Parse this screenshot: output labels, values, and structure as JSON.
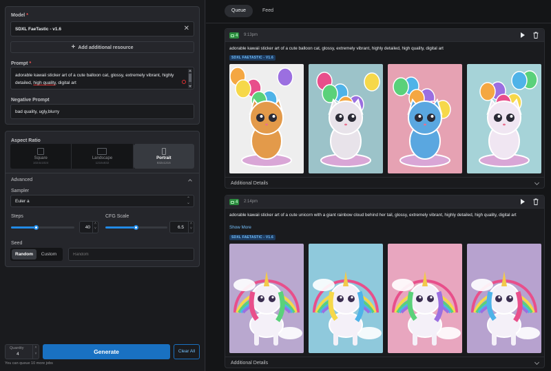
{
  "model": {
    "label": "Model",
    "required": "*",
    "value": "SDXL FaeTastic - v1.6",
    "add_resource": "Add additional resource"
  },
  "prompt": {
    "label": "Prompt",
    "required": "*",
    "text_before": "adorable kawaii sticker art of a cute balloon cat, glossy, extremely vibrant, highly detailed, ",
    "text_underlined": "high quality",
    "text_after": ", digital art"
  },
  "negative_prompt": {
    "label": "Negative Prompt",
    "value": "bad quality, ugly,blurry"
  },
  "aspect_ratio": {
    "label": "Aspect Ratio",
    "options": [
      {
        "name": "Square",
        "size": "1024x1024"
      },
      {
        "name": "Landscape",
        "size": "1216x832"
      },
      {
        "name": "Portrait",
        "size": "832x1216"
      }
    ],
    "selected": "Portrait"
  },
  "advanced": {
    "label": "Advanced",
    "sampler_label": "Sampler",
    "sampler_value": "Euler a",
    "steps_label": "Steps",
    "steps_value": "40",
    "steps_fraction": 0.4,
    "cfg_label": "CFG Scale",
    "cfg_value": "6.5",
    "cfg_fraction": 0.5,
    "seed_label": "Seed",
    "seed_options": [
      "Random",
      "Custom"
    ],
    "seed_selected": "Random",
    "seed_placeholder": "Random"
  },
  "footer": {
    "quantity_label": "Quantity",
    "quantity_value": "4",
    "generate": "Generate",
    "clear_all": "Clear All",
    "queue_note": "You can queue 10 more jobs"
  },
  "tabs": {
    "queue": "Queue",
    "feed": "Feed",
    "active": "Queue"
  },
  "jobs": [
    {
      "count": "4",
      "time": "9:13pm",
      "prompt": "adorable kawaii sticker art of a cute balloon cat, glossy, extremely vibrant, highly detailed, high quality, digital art",
      "model": "SDXL FaeTastic - v1.6",
      "details": "Additional Details",
      "subject": "cat",
      "backgrounds": [
        "#eeeeee",
        "#9cc3c9",
        "#e6a2b3",
        "#a6d3d8"
      ]
    },
    {
      "count": "4",
      "time": "2:14pm",
      "prompt": "adorable kawaii sticker art of a cute unicorn with a giant rainbow cloud behind her tail, glossy, extremely vibrant, highly detailed, high quality, digital art",
      "show_more": "Show More",
      "model": "SDXL FaeTastic - v1.6",
      "details": "Additional Details",
      "subject": "unicorn",
      "backgrounds": [
        "#b9a8cf",
        "#8fc9dc",
        "#e8a6bf",
        "#b7a2cf"
      ]
    }
  ],
  "colors": {
    "accent": "#228be6",
    "background": "#1a1b1e",
    "panel": "#25262b",
    "border": "#373a40",
    "success_badge": "#2b8a3e"
  }
}
